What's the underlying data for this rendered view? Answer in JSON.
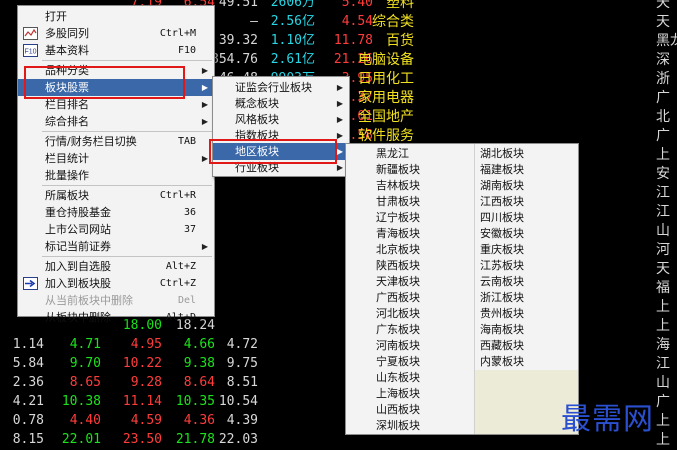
{
  "stock_rows": [
    {
      "c": [
        "",
        "",
        "7.19",
        "6.54",
        "49.51",
        "2606万",
        "5.40",
        "塑料",
        "天"
      ],
      "cls": [
        "w",
        "r",
        "r",
        "r",
        "w",
        "cy",
        "r",
        "y",
        "w"
      ]
    },
    {
      "c": [
        "",
        "",
        "4.36",
        "4.36",
        "—",
        "2.56亿",
        "4.54",
        "综合类",
        "天"
      ],
      "cls": [
        "w",
        "w",
        "w",
        "w",
        "w",
        "cy",
        "r",
        "y",
        "w"
      ]
    },
    {
      "c": [
        "",
        "",
        "7.42",
        "7.57",
        "39.32",
        "1.10亿",
        "11.78",
        "百货",
        "黑龙"
      ],
      "cls": [
        "w",
        "w",
        "g",
        "w",
        "w",
        "cy",
        "r",
        "y",
        "w"
      ]
    },
    {
      "c": [
        "",
        "",
        "4.11",
        "3.89",
        "854.76",
        "2.61亿",
        "21.26",
        "电脑设备",
        "深"
      ],
      "cls": [
        "w",
        "w",
        "r",
        "w",
        "w",
        "cy",
        "r",
        "y",
        "w"
      ]
    },
    {
      "c": [
        "",
        "",
        "",
        "",
        "46.48",
        "9903万",
        "3.95",
        "日用化工",
        "浙"
      ],
      "cls": [
        "w",
        "w",
        "w",
        "w",
        "w",
        "cy",
        "r",
        "y",
        "w"
      ]
    },
    {
      "c": [
        "",
        "",
        "",
        "",
        "15.50",
        "7315万",
        "13.37",
        "家用电器",
        "广"
      ],
      "cls": [
        "w",
        "w",
        "w",
        "w",
        "w",
        "cy",
        "r",
        "y",
        "w"
      ]
    },
    {
      "c": [
        "",
        "",
        "",
        "",
        "29.49",
        "1.61亿",
        "5.01",
        "全国地产",
        "北"
      ],
      "cls": [
        "w",
        "w",
        "w",
        "w",
        "w",
        "cy",
        "r",
        "y",
        "w"
      ]
    },
    {
      "c": [
        "",
        "",
        "",
        "",
        "40.43",
        "1.97亿",
        "15.58",
        "软件服务",
        "广"
      ],
      "cls": [
        "w",
        "w",
        "w",
        "w",
        "w",
        "cy",
        "r",
        "y",
        "w"
      ]
    },
    {
      "c": [
        "",
        "",
        "",
        "",
        "",
        "",
        "",
        "船舶",
        "上"
      ],
      "cls": [
        "w",
        "w",
        "w",
        "w",
        "w",
        "w",
        "w",
        "y",
        "w"
      ]
    },
    {
      "c": [
        "",
        "",
        "",
        "",
        "",
        "",
        "",
        "汽车服务",
        "安"
      ],
      "cls": [
        "w",
        "w",
        "w",
        "w",
        "w",
        "w",
        "w",
        "y",
        "w"
      ]
    },
    {
      "c": [
        "",
        "",
        "14.80",
        "14.18",
        "",
        "",
        "",
        "通信设备",
        "江"
      ],
      "cls": [
        "w",
        "w",
        "r",
        "w",
        "w",
        "w",
        "w",
        "y",
        "w"
      ]
    },
    {
      "c": [
        "",
        "",
        "8.83",
        "8.93",
        "",
        "",
        "",
        "船舶",
        "江"
      ],
      "cls": [
        "w",
        "w",
        "g",
        "w",
        "w",
        "w",
        "w",
        "y",
        "w"
      ]
    },
    {
      "c": [
        "",
        "",
        "11.39",
        "10.85",
        "",
        "",
        "",
        "区域地产",
        "山"
      ],
      "cls": [
        "w",
        "w",
        "r",
        "w",
        "w",
        "w",
        "w",
        "y",
        "w"
      ]
    },
    {
      "c": [
        "",
        "",
        "12.01",
        "11.95",
        "",
        "",
        "",
        "电器仪表",
        "河"
      ],
      "cls": [
        "w",
        "w",
        "r",
        "w",
        "w",
        "w",
        "w",
        "y",
        "w"
      ]
    },
    {
      "c": [
        "",
        "",
        "8.20",
        "8.16",
        "",
        "",
        "",
        "水运",
        "天"
      ],
      "cls": [
        "w",
        "w",
        "r",
        "w",
        "w",
        "w",
        "w",
        "y",
        "w"
      ]
    },
    {
      "c": [
        "",
        "",
        "8.68",
        "8.77",
        "",
        "",
        "",
        "林业",
        "福"
      ],
      "cls": [
        "w",
        "w",
        "g",
        "w",
        "w",
        "w",
        "w",
        "y",
        "w"
      ]
    },
    {
      "c": [
        "",
        "",
        "16.00",
        "15.89",
        "",
        "",
        "",
        "船舶",
        "上"
      ],
      "cls": [
        "w",
        "w",
        "r",
        "w",
        "w",
        "w",
        "w",
        "y",
        "w"
      ]
    },
    {
      "c": [
        "",
        "",
        "18.00",
        "18.24",
        "",
        "",
        "",
        "船舶",
        "上"
      ],
      "cls": [
        "w",
        "w",
        "g",
        "w",
        "w",
        "w",
        "w",
        "y",
        "w"
      ]
    },
    {
      "c": [
        "1.14",
        "4.71",
        "4.95",
        "4.66",
        "4.72",
        "",
        "",
        "区域地产",
        "海"
      ],
      "cls": [
        "w",
        "g",
        "r",
        "g",
        "w",
        "w",
        "w",
        "y",
        "w"
      ]
    },
    {
      "c": [
        "5.84",
        "9.70",
        "10.22",
        "9.38",
        "9.75",
        "",
        "",
        "化工原料",
        "江"
      ],
      "cls": [
        "w",
        "g",
        "r",
        "g",
        "w",
        "w",
        "w",
        "y",
        "w"
      ]
    },
    {
      "c": [
        "2.36",
        "8.65",
        "9.28",
        "8.64",
        "8.51",
        "",
        "",
        "区域地产",
        "山"
      ],
      "cls": [
        "w",
        "r",
        "r",
        "r",
        "w",
        "w",
        "w",
        "y",
        "w"
      ]
    },
    {
      "c": [
        "4.21",
        "10.38",
        "11.14",
        "10.35",
        "10.54",
        "",
        "",
        "元器件",
        "广"
      ],
      "cls": [
        "w",
        "g",
        "r",
        "g",
        "w",
        "w",
        "w",
        "y",
        "w"
      ]
    },
    {
      "c": [
        "0.78",
        "4.40",
        "4.59",
        "4.36",
        "4.39",
        "",
        "",
        "船舶",
        "上"
      ],
      "cls": [
        "w",
        "r",
        "r",
        "r",
        "w",
        "w",
        "w",
        "y",
        "w"
      ]
    },
    {
      "c": [
        "8.15",
        "22.01",
        "23.50",
        "21.78",
        "22.03",
        "",
        "",
        "",
        "上"
      ],
      "cls": [
        "w",
        "g",
        "r",
        "g",
        "w",
        "w",
        "w",
        "y",
        "w"
      ]
    }
  ],
  "main_menu": [
    {
      "label": "打开",
      "type": "item"
    },
    {
      "label": "多股同列",
      "shortcut": "Ctrl+M",
      "icon": "wave-icon",
      "type": "item"
    },
    {
      "label": "基本资料",
      "shortcut": "F10",
      "icon": "f10-icon",
      "type": "item"
    },
    {
      "type": "sep"
    },
    {
      "label": "品种分类",
      "arrow": "▶",
      "type": "item"
    },
    {
      "label": "板块股票",
      "arrow": "▶",
      "type": "item",
      "highlight": true
    },
    {
      "label": "栏目排名",
      "arrow": "▶",
      "type": "item"
    },
    {
      "label": "综合排名",
      "arrow": "▶",
      "type": "item"
    },
    {
      "type": "sep"
    },
    {
      "label": "行情/财务栏目切换",
      "shortcut": "TAB",
      "type": "item"
    },
    {
      "label": "栏目统计",
      "arrow": "▶",
      "type": "item"
    },
    {
      "label": "批量操作",
      "type": "item"
    },
    {
      "type": "sep"
    },
    {
      "label": "所属板块",
      "shortcut": "Ctrl+R",
      "type": "item"
    },
    {
      "label": "重仓持股基金",
      "shortcut": "36",
      "type": "item"
    },
    {
      "label": "上市公司网站",
      "shortcut": "37",
      "type": "item"
    },
    {
      "label": "标记当前证券",
      "arrow": "▶",
      "type": "item"
    },
    {
      "type": "sep"
    },
    {
      "label": "加入到自选股",
      "shortcut": "Alt+Z",
      "type": "item"
    },
    {
      "label": "加入到板块股",
      "shortcut": "Ctrl+Z",
      "icon": "arrow-icon",
      "type": "item"
    },
    {
      "label": "从当前板块中删除",
      "shortcut": "Del",
      "type": "item",
      "disabled": true
    },
    {
      "label": "从板块中删除",
      "shortcut": "Alt+D",
      "type": "item"
    }
  ],
  "sector_menu": [
    {
      "label": "证监会行业板块",
      "arrow": "▶"
    },
    {
      "label": "概念板块",
      "arrow": "▶"
    },
    {
      "label": "风格板块",
      "arrow": "▶"
    },
    {
      "label": "指数板块",
      "arrow": "▶"
    },
    {
      "label": "地区板块",
      "arrow": "▶",
      "highlight": true
    },
    {
      "label": "行业板块",
      "arrow": "▶"
    }
  ],
  "region_col1": [
    "黑龙江",
    "新疆板块",
    "吉林板块",
    "甘肃板块",
    "辽宁板块",
    "青海板块",
    "北京板块",
    "陕西板块",
    "天津板块",
    "广西板块",
    "河北板块",
    "广东板块",
    "河南板块",
    "宁夏板块",
    "山东板块",
    "上海板块",
    "山西板块",
    "深圳板块"
  ],
  "region_col2": [
    "湖北板块",
    "福建板块",
    "湖南板块",
    "江西板块",
    "四川板块",
    "安徽板块",
    "重庆板块",
    "江苏板块",
    "云南板块",
    "浙江板块",
    "贵州板块",
    "海南板块",
    "西藏板块",
    "内蒙板块"
  ],
  "watermark": "最需网",
  "colors": {
    "menu_bg": "#f3f3f3",
    "highlight": "#3b68a8",
    "red_box": "#e01818",
    "background": "#000000"
  }
}
